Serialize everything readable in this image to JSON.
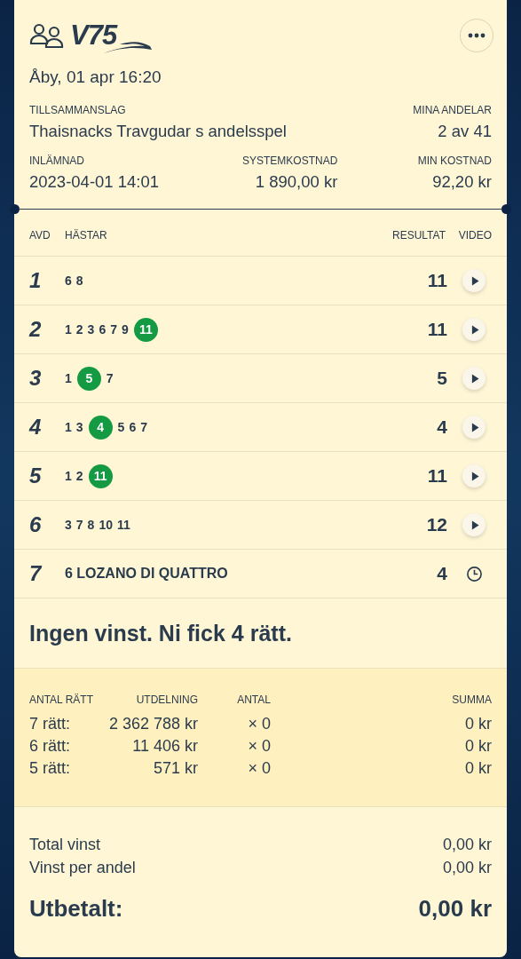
{
  "header": {
    "logo": "V75",
    "date": "Åby, 01 apr 16:20",
    "team_label": "TILLSAMMANSLAG",
    "team": "Thaisnacks Travgudar s andelsspel",
    "shares_label": "MINA ANDELAR",
    "shares": "2 av 41",
    "submitted_label": "INLÄMNAD",
    "submitted": "2023-04-01  14:01",
    "system_cost_label": "SYSTEMKOSTNAD",
    "system_cost": "1 890,00 kr",
    "my_cost_label": "MIN KOSTNAD",
    "my_cost": "92,20 kr"
  },
  "table": {
    "columns": [
      "AVD",
      "HÄSTAR",
      "RESULTAT",
      "VIDEO"
    ],
    "rows": [
      {
        "avd": "1",
        "kind": "picks",
        "horses": [
          {
            "label": "6",
            "winner": false
          },
          {
            "label": "8",
            "winner": false
          }
        ],
        "result": "11",
        "video": {
          "kind": "play"
        }
      },
      {
        "avd": "2",
        "kind": "picks",
        "horses": [
          {
            "label": "1",
            "winner": false
          },
          {
            "label": "2",
            "winner": false
          },
          {
            "label": "3",
            "winner": false
          },
          {
            "label": "6",
            "winner": false
          },
          {
            "label": "7",
            "winner": false
          },
          {
            "label": "9",
            "winner": false
          },
          {
            "label": "11",
            "winner": true
          }
        ],
        "result": "11",
        "video": {
          "kind": "play"
        }
      },
      {
        "avd": "3",
        "kind": "picks",
        "horses": [
          {
            "label": "1",
            "winner": false
          },
          {
            "label": "5",
            "winner": true
          },
          {
            "label": "7",
            "winner": false
          }
        ],
        "result": "5",
        "video": {
          "kind": "play"
        }
      },
      {
        "avd": "4",
        "kind": "picks",
        "horses": [
          {
            "label": "1",
            "winner": false
          },
          {
            "label": "3",
            "winner": false
          },
          {
            "label": "4",
            "winner": true
          },
          {
            "label": "5",
            "winner": false
          },
          {
            "label": "6",
            "winner": false
          },
          {
            "label": "7",
            "winner": false
          }
        ],
        "result": "4",
        "video": {
          "kind": "play"
        }
      },
      {
        "avd": "5",
        "kind": "picks",
        "horses": [
          {
            "label": "1",
            "winner": false
          },
          {
            "label": "2",
            "winner": false
          },
          {
            "label": "11",
            "winner": true
          }
        ],
        "result": "11",
        "video": {
          "kind": "play"
        }
      },
      {
        "avd": "6",
        "kind": "picks",
        "horses": [
          {
            "label": "3",
            "winner": false
          },
          {
            "label": "7",
            "winner": false
          },
          {
            "label": "8",
            "winner": false
          },
          {
            "label": "10",
            "winner": false
          },
          {
            "label": "11",
            "winner": false
          }
        ],
        "result": "12",
        "video": {
          "kind": "play"
        }
      },
      {
        "avd": "7",
        "kind": "single",
        "horses": [
          {
            "label": "6 LOZANO DI QUATTRO"
          }
        ],
        "result": "4",
        "video": {
          "kind": "pending"
        }
      }
    ]
  },
  "message": "Ingen vinst. Ni fick 4 rätt.",
  "payouts": {
    "columns": [
      "ANTAL RÄTT",
      "UTDELNING",
      "ANTAL",
      "SUMMA"
    ],
    "rows": [
      {
        "correct": "7 rätt:",
        "payout": "2 362 788 kr",
        "count": "× 0",
        "sum": "0 kr"
      },
      {
        "correct": "6 rätt:",
        "payout": "11 406 kr",
        "count": "× 0",
        "sum": "0 kr"
      },
      {
        "correct": "5 rätt:",
        "payout": "571 kr",
        "count": "× 0",
        "sum": "0 kr"
      }
    ]
  },
  "totals": [
    {
      "label": "Total vinst",
      "value": "0,00 kr"
    },
    {
      "label": "Vinst per andel",
      "value": "0,00 kr"
    }
  ],
  "paid_out": {
    "label": "Utbetalt:",
    "value": "0,00 kr"
  }
}
